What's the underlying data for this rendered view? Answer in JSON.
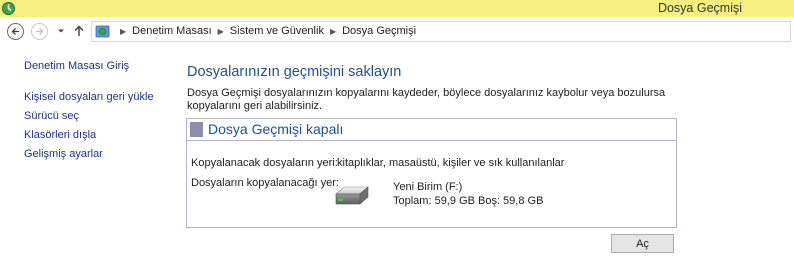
{
  "window": {
    "title": "Dosya Geçmişi",
    "title_bar_color": "#f6ef7f"
  },
  "nav": {
    "back_icon": "back-arrow-icon",
    "forward_icon": "forward-arrow-icon",
    "recent_icon": "chevron-down-icon",
    "up_icon": "up-arrow-icon",
    "breadcrumbs": [
      "Denetim Masası",
      "Sistem ve Güvenlik",
      "Dosya Geçmişi"
    ]
  },
  "sidebar": {
    "home_link": "Denetim Masası Giriş",
    "items": [
      {
        "label": "Kişisel dosyaları geri yükle"
      },
      {
        "label": "Sürücü seç"
      },
      {
        "label": "Klasörleri dışla"
      },
      {
        "label": "Gelişmiş ayarlar"
      }
    ]
  },
  "main": {
    "heading": "Dosyalarınızın geçmişini saklayın",
    "description": "Dosya Geçmişi dosyalarınızın kopyalarını kaydeder, böylece dosyalarınız kaybolur veya bozulursa kopyalarını geri alabilirsiniz.",
    "status": {
      "text": "Dosya Geçmişi kapalı",
      "color": "#8d8fa8"
    },
    "copy_from_label": "Kopyalanacak dosyaların yeri:",
    "copy_from_value": "kitaplıklar, masaüstü, kişiler ve sık kullanılanlar",
    "copy_to_label": "Dosyaların kopyalanacağı yer:",
    "drive": {
      "icon": "hard-drive-icon",
      "name": "Yeni Birim (F:)",
      "size": "Toplam: 59,9 GB Boş: 59,8 GB"
    },
    "turn_on_button": "Aç"
  },
  "colors": {
    "link": "#1e3287",
    "heading": "#1e4f97"
  }
}
